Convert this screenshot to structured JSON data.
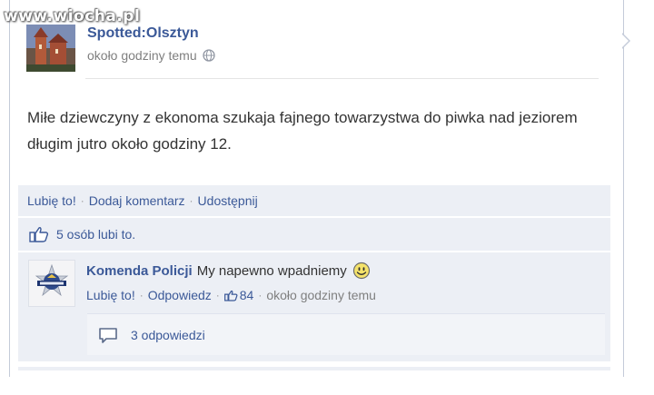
{
  "watermark": "www.wiocha.pl",
  "post": {
    "page_name": "Spotted:Olsztyn",
    "timestamp": "około godziny temu",
    "privacy_icon": "globe-icon",
    "text": "Miłe dziewczyny z ekonoma szukaja fajnego towarzystwa do piwka nad jeziorem długim jutro około godziny 12."
  },
  "actions": {
    "like": "Lubię to!",
    "comment": "Dodaj komentarz",
    "share": "Udostępnij",
    "separator": "·"
  },
  "likes_summary": {
    "icon": "thumbs-up-icon",
    "text": "5 osób lubi to."
  },
  "comment": {
    "author": "Komenda Policji",
    "text": "My napewno wpadniemy",
    "emoticon": "smiley-icon",
    "like": "Lubię to!",
    "reply": "Odpowiedz",
    "like_count": "84",
    "timestamp": "około godziny temu",
    "replies": "3 odpowiedzi"
  },
  "colors": {
    "link": "#3b5998",
    "panel": "#eceff5",
    "meta": "#7f7f7f"
  }
}
